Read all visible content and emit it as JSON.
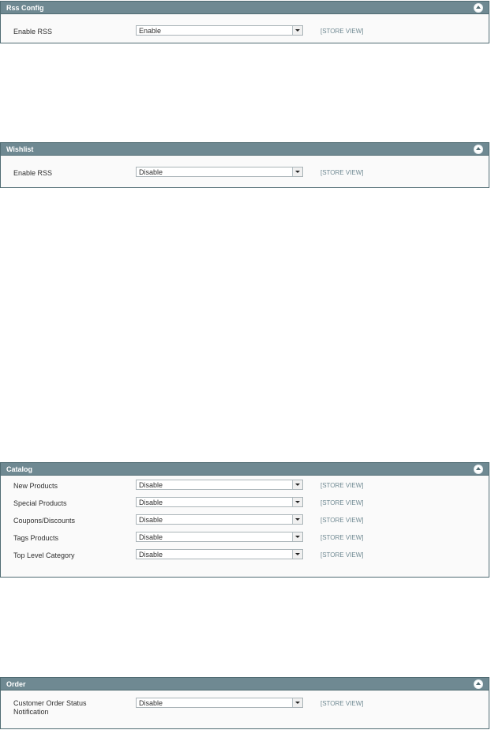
{
  "sections": {
    "rss_config": {
      "title": "Rss Config",
      "rows": [
        {
          "label": "Enable RSS",
          "value": "Enable",
          "scope": "[STORE VIEW]"
        }
      ]
    },
    "wishlist": {
      "title": "Wishlist",
      "rows": [
        {
          "label": "Enable RSS",
          "value": "Disable",
          "scope": "[STORE VIEW]"
        }
      ]
    },
    "catalog": {
      "title": "Catalog",
      "rows": [
        {
          "label": "New Products",
          "value": "Disable",
          "scope": "[STORE VIEW]"
        },
        {
          "label": "Special Products",
          "value": "Disable",
          "scope": "[STORE VIEW]"
        },
        {
          "label": "Coupons/Discounts",
          "value": "Disable",
          "scope": "[STORE VIEW]"
        },
        {
          "label": "Tags Products",
          "value": "Disable",
          "scope": "[STORE VIEW]"
        },
        {
          "label": "Top Level Category",
          "value": "Disable",
          "scope": "[STORE VIEW]"
        }
      ]
    },
    "order": {
      "title": "Order",
      "rows": [
        {
          "label_line1": "Customer Order Status",
          "label_line2": "Notification",
          "value": "Disable",
          "scope": "[STORE VIEW]"
        }
      ]
    }
  }
}
